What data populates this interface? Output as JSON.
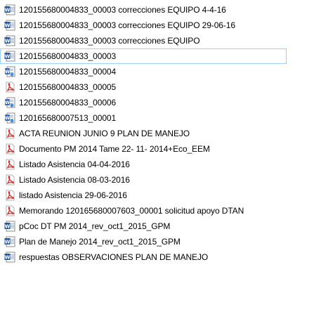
{
  "files": [
    {
      "name": "120155680004833_00003 correcciones EQUIPO 4-4-16",
      "type": "word",
      "icon": "word-document-icon",
      "selected": false
    },
    {
      "name": "120155680004833_00003 correcciones EQUIPO 29-06-16",
      "type": "word",
      "icon": "word-document-icon",
      "selected": false
    },
    {
      "name": "120155680004833_00003 correcciones EQUIPO",
      "type": "word",
      "icon": "word-document-icon",
      "selected": false
    },
    {
      "name": "120155680004833_00003",
      "type": "word",
      "icon": "word-document-icon",
      "selected": true
    },
    {
      "name": "120155680004833_00004",
      "type": "word-legacy",
      "icon": "word-legacy-document-icon",
      "selected": false
    },
    {
      "name": "120155680004833_00005",
      "type": "pdf",
      "icon": "pdf-document-icon",
      "selected": false
    },
    {
      "name": "120155680004833_00006",
      "type": "word-legacy",
      "icon": "word-legacy-document-icon",
      "selected": false
    },
    {
      "name": "120165680007513_00001",
      "type": "word-legacy",
      "icon": "word-legacy-document-icon",
      "selected": false
    },
    {
      "name": "ACTA REUNION JUNIO 9 PLAN DE MANEJO",
      "type": "pdf",
      "icon": "pdf-document-icon",
      "selected": false
    },
    {
      "name": "Documento PM  2014 Tame 22- 11- 2014+Eco_EEM",
      "type": "pdf",
      "icon": "pdf-document-icon",
      "selected": false
    },
    {
      "name": "Listado Asistencia 04-04-2016",
      "type": "pdf",
      "icon": "pdf-document-icon",
      "selected": false
    },
    {
      "name": "Listado Asistencia 08-03-2016",
      "type": "pdf",
      "icon": "pdf-document-icon",
      "selected": false
    },
    {
      "name": "listado Asistencia 29-06-2016",
      "type": "pdf",
      "icon": "pdf-document-icon",
      "selected": false
    },
    {
      "name": "Memorando 120165680007603_00001 solicitud apoyo DTAN",
      "type": "pdf",
      "icon": "pdf-document-icon",
      "selected": false
    },
    {
      "name": "pCoc DT PM  2014_rev_oct1_2015_GPM",
      "type": "word",
      "icon": "word-document-icon",
      "selected": false
    },
    {
      "name": "Plan de Manejo  2014_rev_oct1_2015_GPM",
      "type": "word",
      "icon": "word-document-icon",
      "selected": false
    },
    {
      "name": "respuestas OBSERVACIONES PLAN DE MANEJO",
      "type": "word",
      "icon": "word-document-icon",
      "selected": false
    }
  ],
  "colors": {
    "selection_border": "#99d1ff",
    "word_blue": "#2b5797",
    "pdf_red": "#d32f2f"
  }
}
